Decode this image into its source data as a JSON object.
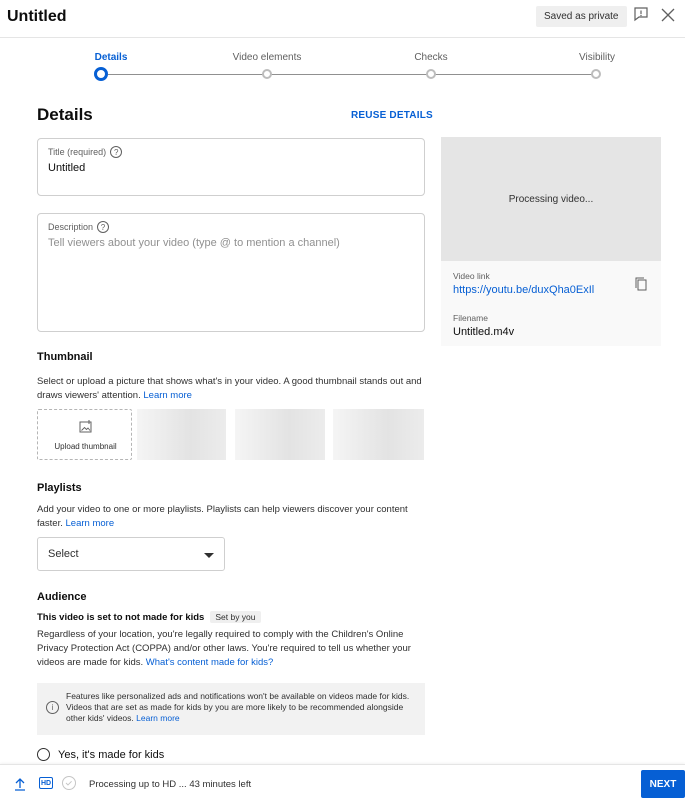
{
  "header": {
    "title": "Untitled",
    "saved_status": "Saved as private"
  },
  "stepper": {
    "steps": [
      {
        "label": "Details",
        "active": true
      },
      {
        "label": "Video elements",
        "active": false
      },
      {
        "label": "Checks",
        "active": false
      },
      {
        "label": "Visibility",
        "active": false
      }
    ]
  },
  "details": {
    "heading": "Details",
    "reuse_label": "REUSE DETAILS",
    "title_field": {
      "label": "Title (required)",
      "value": "Untitled"
    },
    "description_field": {
      "label": "Description",
      "placeholder": "Tell viewers about your video (type @ to mention a channel)"
    }
  },
  "side_panel": {
    "processing_text": "Processing video...",
    "video_link_label": "Video link",
    "video_link": "https://youtu.be/duxQha0ExIl",
    "filename_label": "Filename",
    "filename": "Untitled.m4v"
  },
  "thumbnail": {
    "heading": "Thumbnail",
    "text": "Select or upload a picture that shows what's in your video. A good thumbnail stands out and draws viewers' attention.",
    "learn_more": "Learn more",
    "upload_label": "Upload thumbnail"
  },
  "playlists": {
    "heading": "Playlists",
    "text": "Add your video to one or more playlists. Playlists can help viewers discover your content faster.",
    "learn_more": "Learn more",
    "select_value": "Select"
  },
  "audience": {
    "heading": "Audience",
    "status": "This video is set to not made for kids",
    "set_by": "Set by you",
    "text": "Regardless of your location, you're legally required to comply with the Children's Online Privacy Protection Act (COPPA) and/or other laws. You're required to tell us whether your videos are made for kids.",
    "link": "What's content made for kids?",
    "info_text": "Features like personalized ads and notifications won't be available on videos made for kids. Videos that are set as made for kids by you are more likely to be recommended alongside other kids' videos.",
    "info_link": "Learn more",
    "option_yes": "Yes, it's made for kids"
  },
  "footer": {
    "hd_label": "HD",
    "processing_text": "Processing up to HD ... 43 minutes left",
    "next_label": "NEXT"
  },
  "colors": {
    "accent": "#065fd4",
    "text": "#0d0d0d",
    "muted": "#606060"
  }
}
